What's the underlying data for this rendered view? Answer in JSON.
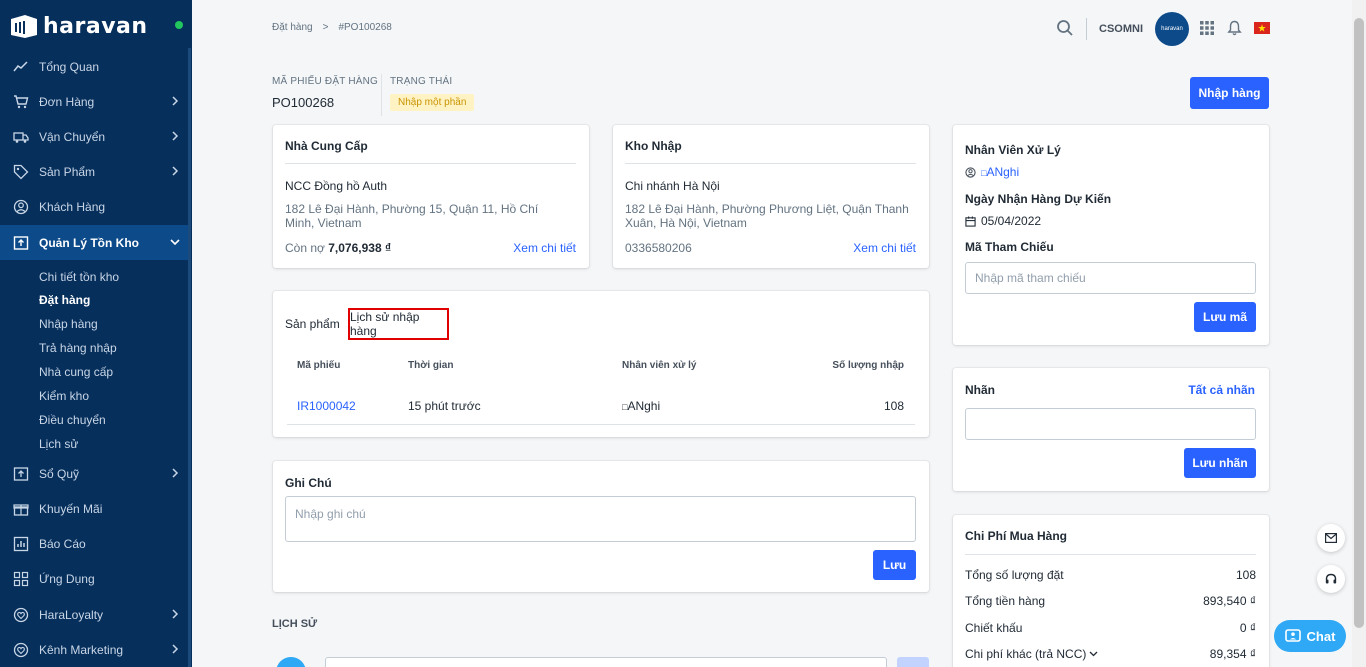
{
  "brand": {
    "name": "haravan"
  },
  "sidebar": {
    "items": [
      {
        "label": "Tổng Quan",
        "icon": "chart-line-icon",
        "chevron": false
      },
      {
        "label": "Đơn Hàng",
        "icon": "cart-icon",
        "chevron": true
      },
      {
        "label": "Vận Chuyển",
        "icon": "truck-icon",
        "chevron": true
      },
      {
        "label": "Sản Phẩm",
        "icon": "tag-icon",
        "chevron": true
      },
      {
        "label": "Khách Hàng",
        "icon": "user-circle-icon",
        "chevron": false
      },
      {
        "label": "Quản Lý Tồn Kho",
        "icon": "inventory-icon",
        "chevron": true
      },
      {
        "label": "Sổ Quỹ",
        "icon": "cashbook-icon",
        "chevron": true
      },
      {
        "label": "Khuyến Mãi",
        "icon": "gift-icon",
        "chevron": false
      },
      {
        "label": "Báo Cáo",
        "icon": "report-icon",
        "chevron": false
      },
      {
        "label": "Ứng Dụng",
        "icon": "apps-icon",
        "chevron": false
      },
      {
        "label": "HaraLoyalty",
        "icon": "heart-icon",
        "chevron": true
      },
      {
        "label": "Kênh Marketing",
        "icon": "heart-icon",
        "chevron": true
      }
    ],
    "sub_items": [
      "Chi tiết tồn kho",
      "Đặt hàng",
      "Nhập hàng",
      "Trả hàng nhập",
      "Nhà cung cấp",
      "Kiểm kho",
      "Điều chuyển",
      "Lịch sử"
    ]
  },
  "breadcrumb": {
    "parent": "Đặt hàng",
    "separator": ">",
    "current": "#PO100268"
  },
  "topbar": {
    "username": "CSOMNI",
    "avatar_text": "haravan"
  },
  "header": {
    "po_label": "MÃ PHIẾU ĐẶT HÀNG",
    "po_value": "PO100268",
    "status_label": "TRẠNG THÁI",
    "status_value": "Nhập một phần",
    "import_button": "Nhập hàng"
  },
  "supplier": {
    "title": "Nhà Cung Cấp",
    "name": "NCC Đồng hồ Auth",
    "address": "182 Lê Đại Hành, Phường 15, Quận 11, Hồ Chí Minh, Vietnam",
    "debt_label": "Còn nợ",
    "debt_value": "7,076,938 ₫",
    "detail_link": "Xem chi tiết"
  },
  "warehouse": {
    "title": "Kho Nhập",
    "name": "Chi nhánh Hà Nội",
    "address": "182 Lê Đại Hành, Phường Phương Liệt, Quận Thanh Xuân, Hà Nội, Vietnam",
    "phone": "0336580206",
    "detail_link": "Xem chi tiết"
  },
  "tabs": {
    "products": "Sản phẩm",
    "history": "Lịch sử nhập hàng"
  },
  "history_table": {
    "columns": [
      "Mã phiếu",
      "Thời gian",
      "Nhân viên xử lý",
      "Số lượng nhập"
    ],
    "rows": [
      {
        "code": "IR1000042",
        "time": "15 phút trước",
        "staff": "ANghi",
        "qty": "108"
      }
    ]
  },
  "note": {
    "title": "Ghi Chú",
    "placeholder": "Nhập ghi chú",
    "save": "Lưu"
  },
  "log": {
    "title": "LỊCH SỬ"
  },
  "staff": {
    "title": "Nhân Viên Xử Lý",
    "name": "ANghi",
    "date_title": "Ngày Nhận Hàng Dự Kiến",
    "date_value": "05/04/2022",
    "ref_title": "Mã Tham Chiếu",
    "ref_placeholder": "Nhập mã tham chiếu",
    "ref_save": "Lưu mã"
  },
  "tags": {
    "title": "Nhãn",
    "all_link": "Tất cả nhãn",
    "save": "Lưu nhãn"
  },
  "costs": {
    "title": "Chi Phí Mua Hàng",
    "rows": [
      {
        "label": "Tổng số lượng đặt",
        "value": "108"
      },
      {
        "label": "Tổng tiền hàng",
        "value": "893,540 ₫"
      },
      {
        "label": "Chiết khấu",
        "value": "0 ₫"
      },
      {
        "label": "Chi phí khác (trả NCC)",
        "value": "89,354 ₫"
      }
    ]
  },
  "chat": {
    "label": "Chat"
  },
  "colors": {
    "sidebar": "#062f5c",
    "accent": "#2962ff",
    "badge_bg": "#fff3c4",
    "badge_text": "#c99400",
    "highlight": "#e00000"
  }
}
